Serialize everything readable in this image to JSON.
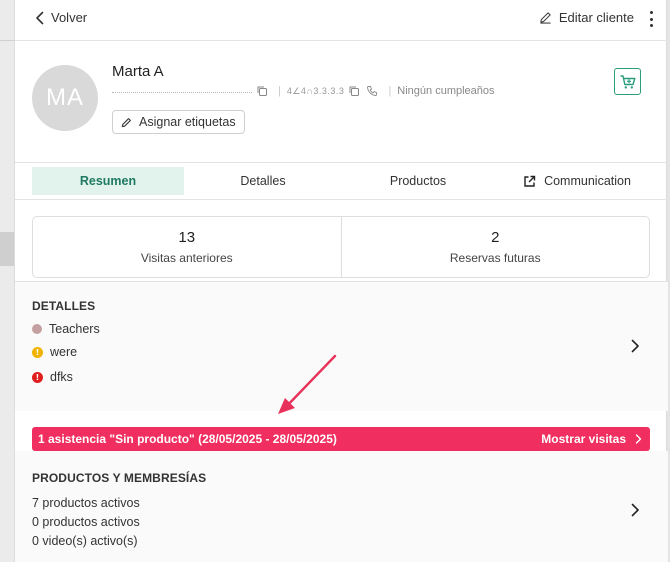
{
  "topbar": {
    "back_label": "Volver",
    "edit_label": "Editar cliente"
  },
  "client": {
    "initials": "MA",
    "name": "Marta A",
    "phone_masked": "4∠4∩3.3.3.3",
    "birthday": "Ningún cumpleaños",
    "assign_tags_label": "Asignar etiquetas"
  },
  "tabs": [
    {
      "label": "Resumen",
      "active": true
    },
    {
      "label": "Detalles",
      "active": false
    },
    {
      "label": "Productos",
      "active": false
    },
    {
      "label": "Communication",
      "active": false
    }
  ],
  "stats": [
    {
      "value": "13",
      "label": "Visitas anteriores"
    },
    {
      "value": "2",
      "label": "Reservas futuras"
    }
  ],
  "details": {
    "title": "DETALLES",
    "items": [
      {
        "label": "Teachers",
        "color": "#c4a0a0",
        "icon": "dot"
      },
      {
        "label": "were",
        "color": "#f0b400",
        "icon": "warning-icon"
      },
      {
        "label": "dfks",
        "color": "#e01e1e",
        "icon": "warning-icon"
      }
    ]
  },
  "alert": {
    "text": "1 asistencia \"Sin producto\" (28/05/2025 - 28/05/2025)",
    "action": "Mostrar visitas",
    "color": "#f02e5f"
  },
  "products": {
    "title": "PRODUCTOS Y MEMBRESÍAS",
    "lines": [
      "7 productos activos",
      "0 productos activos",
      "0 video(s) activo(s)"
    ]
  },
  "colors": {
    "accent": "#2a9d7d",
    "tab_active_bg": "#e2f3ee",
    "annotation_arrow": "#e8315a"
  }
}
